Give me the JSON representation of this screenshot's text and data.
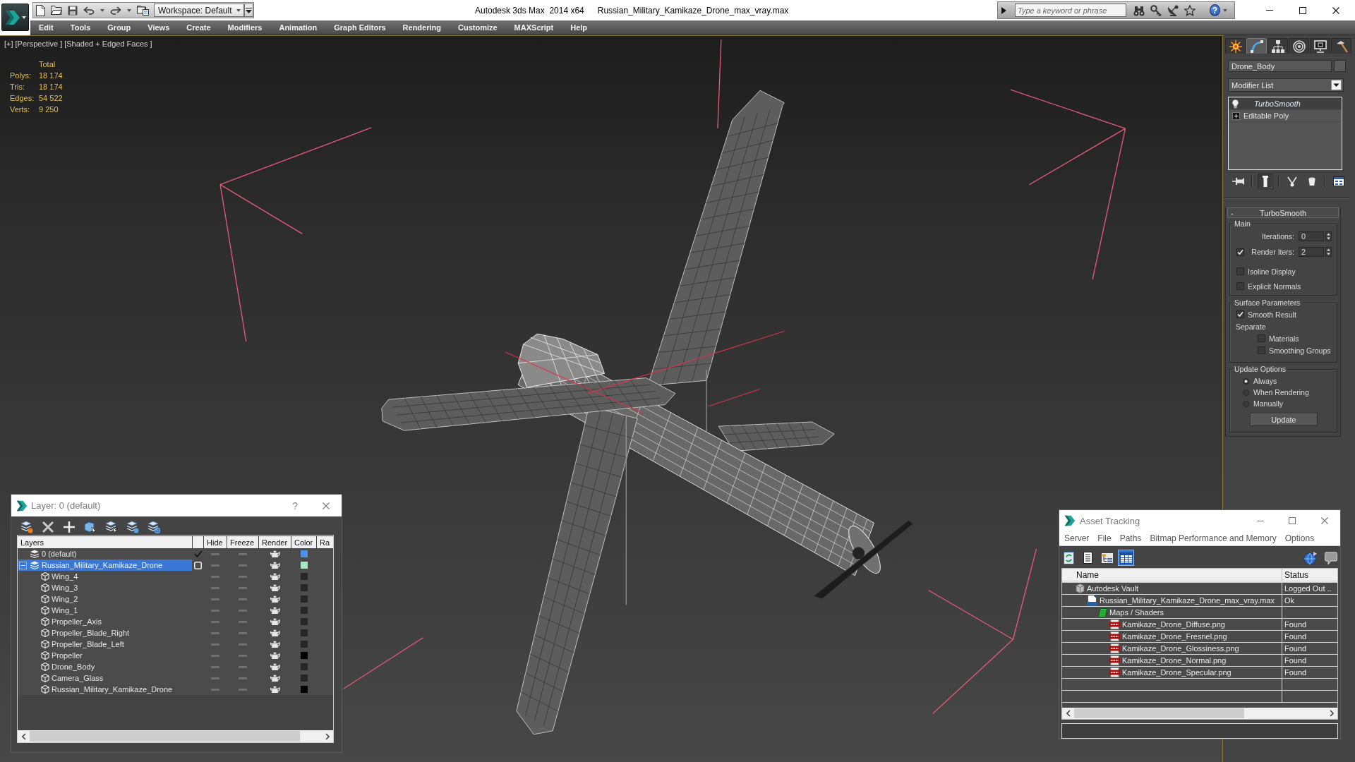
{
  "title_bar": {
    "workspace": "Workspace: Default",
    "app_title": "Autodesk 3ds Max  2014 x64",
    "file_title": "Russian_Military_Kamikaze_Drone_max_vray.max",
    "search": {
      "placeholder": "Type a keyword or phrase"
    },
    "help": "?"
  },
  "menu_bar": [
    "Edit",
    "Tools",
    "Group",
    "Views",
    "Create",
    "Modifiers",
    "Animation",
    "Graph Editors",
    "Rendering",
    "Customize",
    "MAXScript",
    "Help"
  ],
  "viewport": {
    "labels": [
      "[+]",
      "[Perspective ]",
      "[Shaded + Edged Faces ]"
    ],
    "stats": {
      "header": "Total",
      "rows": [
        {
          "label": "Polys:",
          "value": "18 174"
        },
        {
          "label": "Tris:",
          "value": "18 174"
        },
        {
          "label": "Edges:",
          "value": "54 522"
        },
        {
          "label": "Verts:",
          "value": "9 250"
        }
      ]
    }
  },
  "command_panel": {
    "tabs": [
      {
        "kind": "create",
        "selected": false
      },
      {
        "kind": "modify",
        "selected": true
      },
      {
        "kind": "hierarchy",
        "selected": false
      },
      {
        "kind": "motion",
        "selected": false
      },
      {
        "kind": "display",
        "selected": false
      },
      {
        "kind": "utilities",
        "selected": false
      }
    ],
    "object_name": "Drone_Body",
    "modifier_list": "Modifier List",
    "stack": [
      {
        "label": "TurboSmooth",
        "kind": "modifier",
        "selected": true,
        "on": true
      },
      {
        "label": "Editable Poly",
        "kind": "object",
        "selected": false,
        "expanded": false
      }
    ],
    "stack_tools": [
      {
        "kind": "pin",
        "on": false
      },
      {
        "kind": "end-result",
        "on": true
      },
      {
        "kind": "make-unique",
        "on": false
      },
      {
        "kind": "remove",
        "on": false
      },
      {
        "kind": "configure",
        "on": false
      }
    ],
    "rollout": {
      "title": "TurboSmooth",
      "toggle": "-",
      "groups": [
        {
          "title": "Main",
          "items": [
            {
              "kind": "spinner",
              "label": "Iterations:",
              "value": "0"
            },
            {
              "kind": "check-spinner",
              "label": "Render Iters:",
              "checked": true,
              "value": "2"
            },
            {
              "kind": "checkbox",
              "label": "Isoline Display",
              "checked": false
            },
            {
              "kind": "checkbox",
              "label": "Explicit Normals",
              "checked": false
            }
          ]
        },
        {
          "title": "Surface Parameters",
          "items": [
            {
              "kind": "checkbox",
              "label": "Smooth Result",
              "checked": true
            },
            {
              "kind": "label",
              "label": "Separate"
            },
            {
              "kind": "sub-checkbox",
              "label": "Materials",
              "checked": false
            },
            {
              "kind": "sub-checkbox",
              "label": "Smoothing Groups",
              "checked": false
            }
          ]
        },
        {
          "title": "Update Options",
          "items": [
            {
              "kind": "radio",
              "label": "Always",
              "selected": true
            },
            {
              "kind": "radio",
              "label": "When Rendering",
              "selected": false
            },
            {
              "kind": "radio",
              "label": "Manually",
              "selected": false
            },
            {
              "kind": "button",
              "label": "Update"
            }
          ]
        }
      ]
    }
  },
  "layer_dialog": {
    "title": "Layer: 0 (default)",
    "help": "?",
    "columns": [
      "Layers",
      "Hide",
      "Freeze",
      "Render",
      "Color",
      "Ra"
    ],
    "rows": [
      {
        "name": "0 (default)",
        "kind": "layer",
        "active": true,
        "selected": false,
        "hidden": false,
        "frozen": false,
        "renderable": true,
        "color": "#4f8fe6"
      },
      {
        "name": "Russian_Military_Kamikaze_Drone",
        "kind": "layer",
        "active": false,
        "selected": true,
        "expanded": true,
        "hidden": false,
        "frozen": false,
        "renderable": true,
        "color": "#a6e6c4",
        "children": [
          {
            "name": "Wing_4",
            "kind": "object",
            "selected": false,
            "hidden": false,
            "frozen": false,
            "renderable": true,
            "color": "#262626"
          },
          {
            "name": "Wing_3",
            "kind": "object",
            "selected": false,
            "hidden": false,
            "frozen": false,
            "renderable": true,
            "color": "#262626"
          },
          {
            "name": "Wing_2",
            "kind": "object",
            "selected": false,
            "hidden": false,
            "frozen": false,
            "renderable": true,
            "color": "#262626"
          },
          {
            "name": "Wing_1",
            "kind": "object",
            "selected": false,
            "hidden": false,
            "frozen": false,
            "renderable": true,
            "color": "#262626"
          },
          {
            "name": "Propeller_Axis",
            "kind": "object",
            "selected": false,
            "hidden": false,
            "frozen": false,
            "renderable": true,
            "color": "#262626"
          },
          {
            "name": "Propeller_Blade_Right",
            "kind": "object",
            "selected": false,
            "hidden": false,
            "frozen": false,
            "renderable": true,
            "color": "#262626"
          },
          {
            "name": "Propeller_Blade_Left",
            "kind": "object",
            "selected": false,
            "hidden": false,
            "frozen": false,
            "renderable": true,
            "color": "#262626"
          },
          {
            "name": "Propeller",
            "kind": "object",
            "selected": false,
            "hidden": false,
            "frozen": false,
            "renderable": true,
            "color": "#000000"
          },
          {
            "name": "Drone_Body",
            "kind": "object",
            "selected": false,
            "hidden": false,
            "frozen": false,
            "renderable": true,
            "color": "#262626"
          },
          {
            "name": "Camera_Glass",
            "kind": "object",
            "selected": false,
            "hidden": false,
            "frozen": false,
            "renderable": true,
            "color": "#262626"
          },
          {
            "name": "Russian_Military_Kamikaze_Drone",
            "kind": "object",
            "selected": false,
            "hidden": false,
            "frozen": false,
            "renderable": true,
            "color": "#000000"
          }
        ]
      }
    ]
  },
  "asset_tracking": {
    "title": "Asset Tracking",
    "menu": [
      "Server",
      "File",
      "Paths",
      "Bitmap Performance and Memory",
      "Options"
    ],
    "toolbar": [
      {
        "kind": "refresh",
        "selected": false
      },
      {
        "kind": "list",
        "selected": false
      },
      {
        "kind": "tree",
        "selected": false
      },
      {
        "kind": "table",
        "selected": true
      }
    ],
    "columns": [
      "Name",
      "Status"
    ],
    "rows": [
      {
        "name": "Autodesk Vault",
        "kind": "vault",
        "status": "Logged Out ..",
        "children": [
          {
            "name": "Russian_Military_Kamikaze_Drone_max_vray.max",
            "kind": "max",
            "status": "Ok",
            "children": [
              {
                "name": "Maps / Shaders",
                "kind": "folder",
                "children": [
                  {
                    "name": "Kamikaze_Drone_Diffuse.png",
                    "kind": "png",
                    "status": "Found"
                  },
                  {
                    "name": "Kamikaze_Drone_Fresnel.png",
                    "kind": "png",
                    "status": "Found"
                  },
                  {
                    "name": "Kamikaze_Drone_Glossiness.png",
                    "kind": "png",
                    "status": "Found"
                  },
                  {
                    "name": "Kamikaze_Drone_Normal.png",
                    "kind": "png",
                    "status": "Found"
                  },
                  {
                    "name": "Kamikaze_Drone_Specular.png",
                    "kind": "png",
                    "status": "Found"
                  }
                ]
              }
            ]
          }
        ]
      }
    ]
  }
}
